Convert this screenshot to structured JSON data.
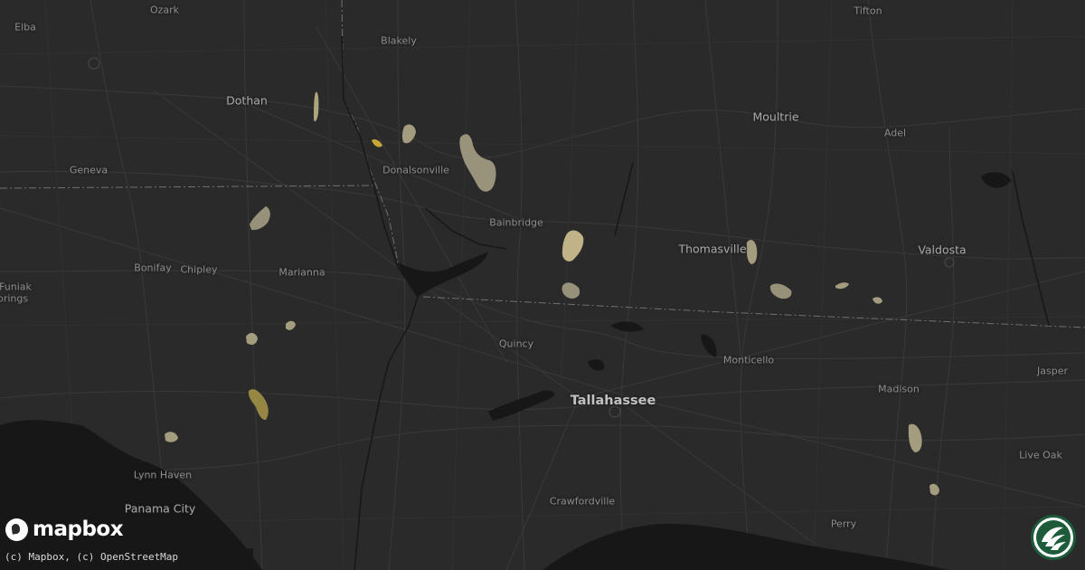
{
  "map": {
    "background": "#2a2a2a",
    "water_color": "#161616",
    "road_color": "#3b3b3b",
    "border_color": "#6e6e6e",
    "hail_swath_colors": [
      "#a39c83",
      "#c7bb8c",
      "#9b8c45",
      "#c4a638"
    ]
  },
  "places": [
    {
      "name": "Ozark",
      "size": "small"
    },
    {
      "name": "Elba",
      "size": "small"
    },
    {
      "name": "Blakely",
      "size": "small"
    },
    {
      "name": "Tifton",
      "size": "small"
    },
    {
      "name": "Dothan",
      "size": "medium"
    },
    {
      "name": "Moultrie",
      "size": "medium"
    },
    {
      "name": "Adel",
      "size": "small"
    },
    {
      "name": "Donalsonville",
      "size": "small"
    },
    {
      "name": "Geneva",
      "size": "small"
    },
    {
      "name": "Bainbridge",
      "size": "small"
    },
    {
      "name": "Thomasville",
      "size": "medium"
    },
    {
      "name": "Valdosta",
      "size": "medium"
    },
    {
      "name": "Bonifay",
      "size": "small"
    },
    {
      "name": "Chipley",
      "size": "small"
    },
    {
      "name": "Marianna",
      "size": "small"
    },
    {
      "name": "Funiak",
      "size": "small"
    },
    {
      "name": "prings",
      "size": "small"
    },
    {
      "name": "Quincy",
      "size": "small"
    },
    {
      "name": "Monticello",
      "size": "small"
    },
    {
      "name": "Jasper",
      "size": "small"
    },
    {
      "name": "Tallahassee",
      "size": "large"
    },
    {
      "name": "Madison",
      "size": "small"
    },
    {
      "name": "Live Oak",
      "size": "small"
    },
    {
      "name": "Lynn Haven",
      "size": "small"
    },
    {
      "name": "Panama City",
      "size": "medium"
    },
    {
      "name": "Crawfordville",
      "size": "small"
    },
    {
      "name": "Perry",
      "size": "small"
    }
  ],
  "logo": {
    "wordmark": "mapbox"
  },
  "attribution": "(c) Mapbox, (c) OpenStreetMap",
  "badge": {
    "icon": "hail-recon-logo-icon"
  }
}
